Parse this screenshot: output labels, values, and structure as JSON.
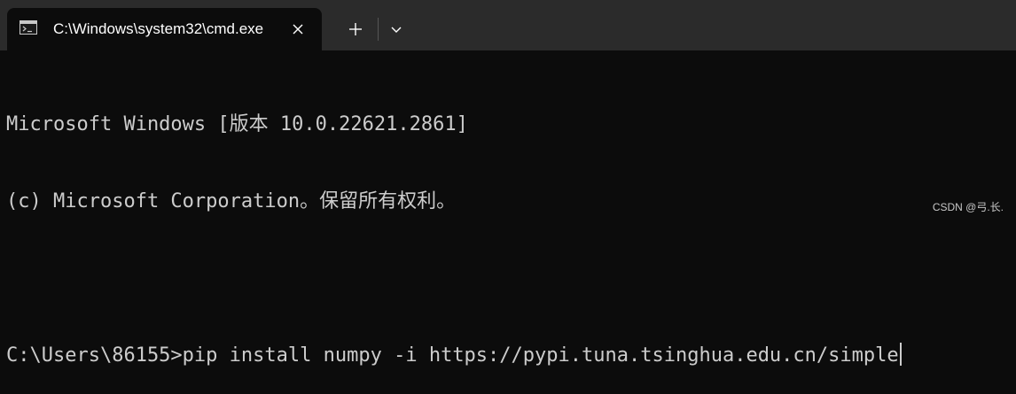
{
  "window": {
    "tab_title": "C:\\Windows\\system32\\cmd.exe",
    "icons": {
      "tab": "terminal-icon",
      "close": "close-icon",
      "new_tab": "plus-icon",
      "dropdown": "chevron-down-icon"
    }
  },
  "console": {
    "lines": [
      "Microsoft Windows [版本 10.0.22621.2861]",
      "(c) Microsoft Corporation。保留所有权利。",
      "",
      "C:\\Users\\86155>pip install numpy -i https://pypi.tuna.tsinghua.edu.cn/simple"
    ]
  },
  "watermark": "CSDN @弓.长.",
  "colors": {
    "background": "#0c0c0c",
    "titlebar": "#2b2b2b",
    "text": "#cccccc"
  }
}
